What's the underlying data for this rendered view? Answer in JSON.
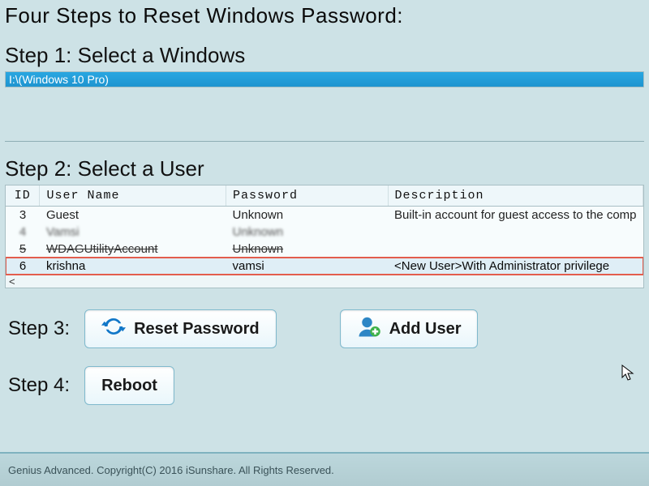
{
  "page": {
    "title": "Four Steps to Reset Windows Password:"
  },
  "step1": {
    "label": "Step 1: Select a Windows",
    "selected_text": "I:\\(Windows 10 Pro)"
  },
  "step2": {
    "label": "Step 2: Select a User",
    "columns": {
      "id": "ID",
      "user": "User Name",
      "pwd": "Password",
      "desc": "Description"
    },
    "rows": [
      {
        "id": "3",
        "user": "Guest",
        "pwd": "Unknown",
        "desc": "Built-in account for guest access to the comp"
      },
      {
        "id": "4",
        "user": "Vamsi",
        "pwd": "Unknown",
        "desc": ""
      },
      {
        "id": "5",
        "user": "WDAGUtilityAccount",
        "pwd": "Unknown",
        "desc": ""
      },
      {
        "id": "6",
        "user": "krishna",
        "pwd": "vamsi",
        "desc": "<New User>With Administrator privilege"
      }
    ],
    "scroll_marker": "<"
  },
  "step3": {
    "label": "Step 3:",
    "reset_btn": "Reset Password",
    "add_btn": "Add User"
  },
  "step4": {
    "label": "Step 4:",
    "reboot_btn": "Reboot"
  },
  "footer": {
    "text": "Genius Advanced. Copyright(C) 2016 iSunshare. All Rights Reserved."
  }
}
